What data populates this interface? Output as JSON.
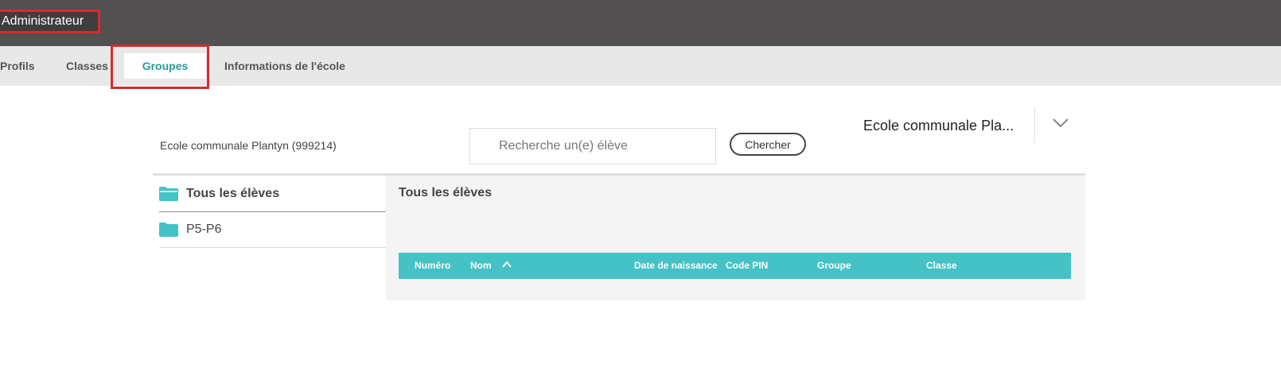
{
  "header": {
    "title": "Administrateur"
  },
  "nav": {
    "tabs": [
      {
        "label": "Profils"
      },
      {
        "label": "Classes"
      },
      {
        "label": "Groupes",
        "active": true
      },
      {
        "label": "Informations de l'école"
      }
    ]
  },
  "school": {
    "label": "Ecole communale Plantyn (999214)",
    "selected": "Ecole communale Pla..."
  },
  "search": {
    "placeholder": "Recherche un(e) élève",
    "value": "",
    "button_label": "Chercher"
  },
  "sidebar": {
    "items": [
      {
        "label": "Tous les élèves",
        "icon": "folder-open-icon"
      },
      {
        "label": "P5-P6",
        "icon": "folder-icon"
      }
    ]
  },
  "main": {
    "title": "Tous les élèves",
    "table": {
      "columns": [
        {
          "label": "Numéro"
        },
        {
          "label": "Nom",
          "sort": "ascending"
        },
        {
          "label": "Date de naissance"
        },
        {
          "label": "Code PIN"
        },
        {
          "label": "Groupe"
        },
        {
          "label": "Classe"
        }
      ],
      "rows": []
    }
  },
  "colors": {
    "topbar": "#525050",
    "accent": "#45c2c5",
    "active_tab_text": "#2a9a9a",
    "highlight": "#d92b2b"
  }
}
